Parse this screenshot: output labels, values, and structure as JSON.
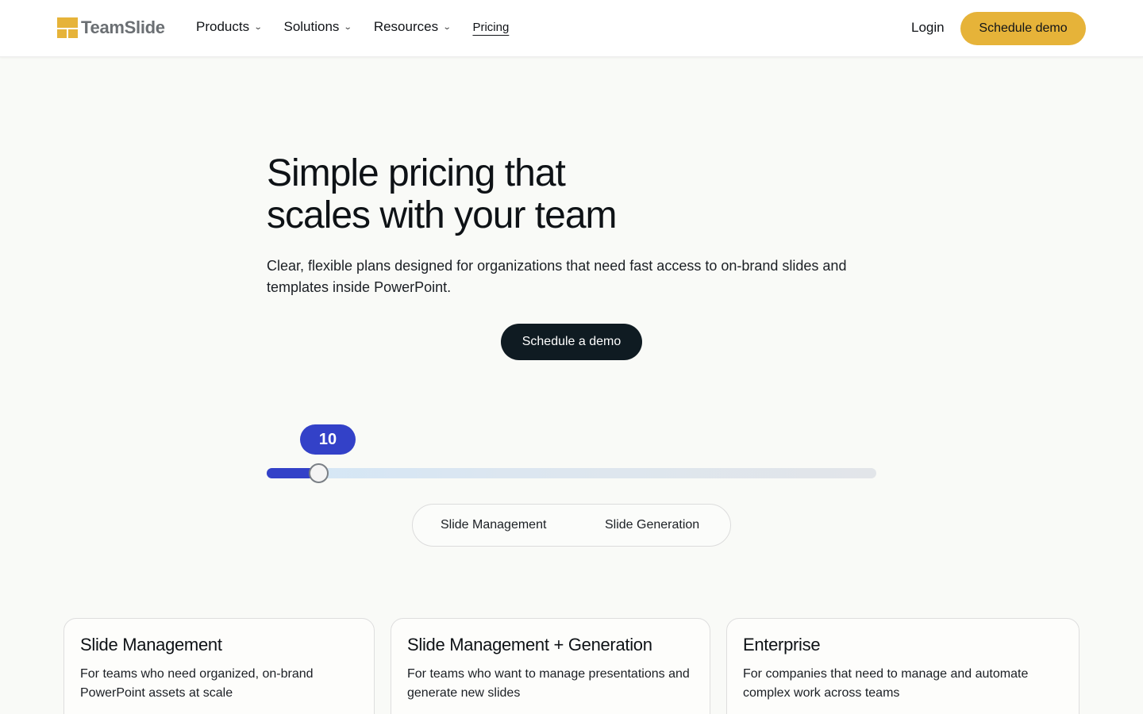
{
  "header": {
    "logo_text": "TeamSlide",
    "nav": [
      {
        "label": "Products",
        "has_dropdown": true
      },
      {
        "label": "Solutions",
        "has_dropdown": true
      },
      {
        "label": "Resources",
        "has_dropdown": true
      },
      {
        "label": "Pricing",
        "has_dropdown": false
      }
    ],
    "login_label": "Login",
    "cta_label": "Schedule demo",
    "chevron_glyph": "⌄"
  },
  "hero": {
    "title_line1": "Simple pricing that",
    "title_line2": "scales with your team",
    "subtitle": "Clear, flexible plans designed for organizations that need fast access to on-brand slides and templates inside PowerPoint.",
    "cta_label": "Schedule a demo"
  },
  "slider": {
    "value": "10",
    "fill_fraction": 0.086
  },
  "toggle": {
    "options": [
      "Slide Management",
      "Slide Generation"
    ]
  },
  "plans": [
    {
      "title": "Slide Management",
      "description": "For teams who need organized, on-brand PowerPoint assets at scale"
    },
    {
      "title": "Slide Management + Generation",
      "description": "For teams who want to manage presentations and generate new slides"
    },
    {
      "title": "Enterprise",
      "description": "For companies that need to manage and automate complex work across teams"
    }
  ],
  "colors": {
    "accent_yellow": "#e6b339",
    "accent_blue": "#3341c8",
    "dark_button": "#0f1b22",
    "background": "#f9faf7"
  }
}
